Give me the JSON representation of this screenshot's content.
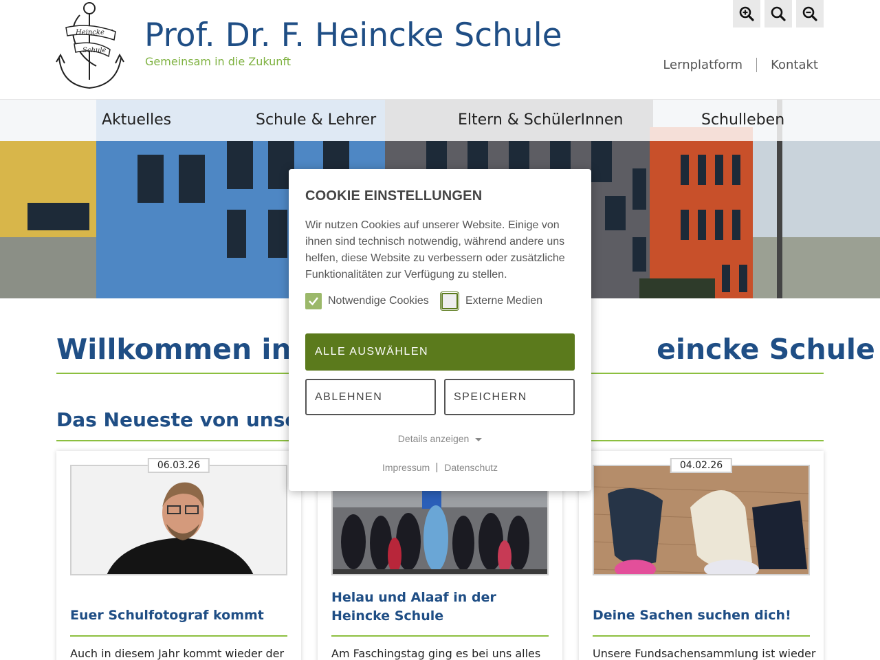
{
  "header": {
    "title": "Prof. Dr. F. Heincke Schule",
    "subtitle": "Gemeinsam in die Zukunft",
    "logo_line1": "Heincke",
    "logo_line2": "Schule",
    "zoom_in_icon": "zoom-in-icon",
    "zoom_reset_icon": "search-icon",
    "zoom_out_icon": "zoom-out-icon",
    "top_links": [
      "Lernplatform",
      "Kontakt"
    ]
  },
  "nav": {
    "items": [
      "Aktuelles",
      "Schule & Lehrer",
      "Eltern & SchülerInnen",
      "Schulleben"
    ]
  },
  "main": {
    "heading_start": "Willkommen in de",
    "heading_end": "eincke Schule",
    "subheading": "Das Neueste von unsere"
  },
  "cards": [
    {
      "date": "06.03.26",
      "title": "Euer Schulfotograf kommt",
      "text": "Auch in diesem Jahr kommt wieder der"
    },
    {
      "date": "",
      "title": "Helau und Alaaf in der Heincke Schule",
      "text": "Am Faschingstag ging es bei uns alles"
    },
    {
      "date": "04.02.26",
      "title": "Deine Sachen suchen dich!",
      "text": "Unsere Fundsachensammlung ist wieder"
    }
  ],
  "cookie": {
    "title": "COOKIE EINSTELLUNGEN",
    "text": "Wir nutzen Cookies auf unserer Website. Einige von ihnen sind technisch notwendig, während andere uns helfen, diese Website zu verbessern oder zusätzliche Funktionalitäten zur Verfügung zu stellen.",
    "checkbox_necessary": "Notwendige Cookies",
    "checkbox_necessary_checked": true,
    "checkbox_external": "Externe Medien",
    "checkbox_external_checked": false,
    "accept_all": "ALLE AUSWÄHLEN",
    "decline": "ABLEHNEN",
    "save": "SPEICHERN",
    "details": "Details anzeigen",
    "link_imprint": "Impressum",
    "link_privacy": "Datenschutz"
  },
  "colors": {
    "brand_blue": "#1f4e85",
    "brand_green": "#7fb241",
    "button_green": "#5b7a1c"
  }
}
